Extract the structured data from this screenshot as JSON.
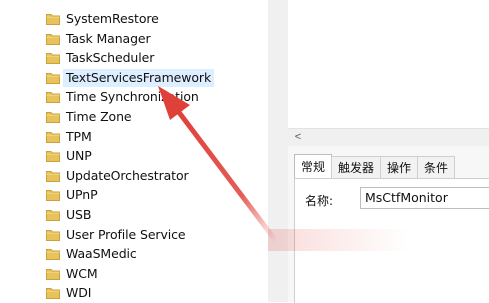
{
  "tree": {
    "items": [
      {
        "label": "SystemRestore"
      },
      {
        "label": "Task Manager"
      },
      {
        "label": "TaskScheduler"
      },
      {
        "label": "TextServicesFramework",
        "selected": true
      },
      {
        "label": "Time Synchronization"
      },
      {
        "label": "Time Zone"
      },
      {
        "label": "TPM"
      },
      {
        "label": "UNP"
      },
      {
        "label": "UpdateOrchestrator"
      },
      {
        "label": "UPnP"
      },
      {
        "label": "USB"
      },
      {
        "label": "User Profile Service"
      },
      {
        "label": "WaaSMedic"
      },
      {
        "label": "WCM"
      },
      {
        "label": "WDI"
      }
    ]
  },
  "scrollbar": {
    "left_arrow": "<"
  },
  "properties": {
    "tabs": [
      {
        "label": "常规",
        "active": true
      },
      {
        "label": "触发器"
      },
      {
        "label": "操作"
      },
      {
        "label": "条件"
      }
    ],
    "name_label": "名称:",
    "name_value": "MsCtfMonitor"
  },
  "colors": {
    "folder": "#e8c25a",
    "selection": "#dceeff",
    "arrow": "#e0403a"
  }
}
